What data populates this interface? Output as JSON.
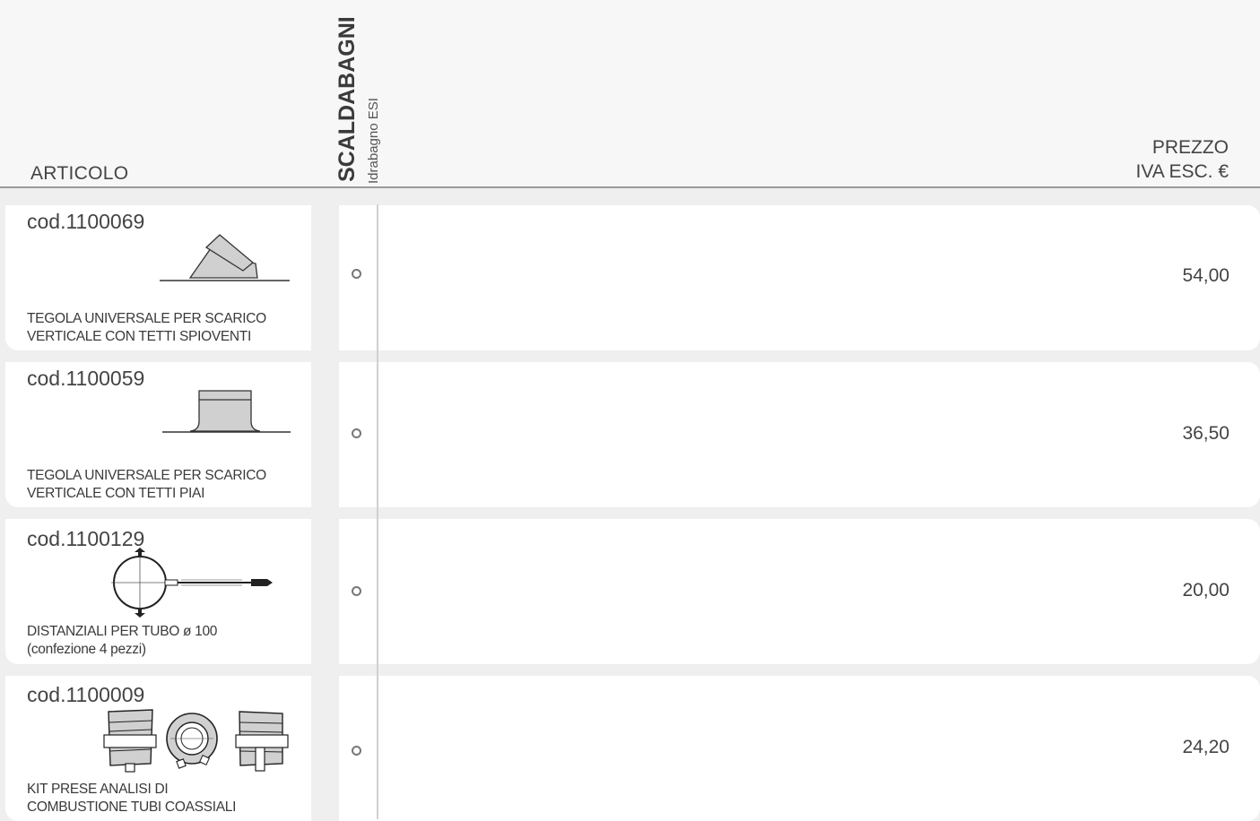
{
  "header": {
    "articolo_label": "ARTICOLO",
    "category_title": "SCALDABAGNI",
    "category_subtitle": "Idrabagno ESI",
    "price_line1": "PREZZO",
    "price_line2": "IVA ESC. €"
  },
  "rows": [
    {
      "code": "cod.1100069",
      "desc_line1": "TEGOLA UNIVERSALE PER SCARICO",
      "desc_line2": "VERTICALE CON TETTI SPIOVENTI",
      "price": "54,00",
      "icon": "sloped-roof-tile-icon"
    },
    {
      "code": "cod.1100059",
      "desc_line1": "TEGOLA UNIVERSALE PER SCARICO",
      "desc_line2": "VERTICALE CON TETTI PIAI",
      "price": "36,50",
      "icon": "flat-roof-tile-icon"
    },
    {
      "code": "cod.1100129",
      "desc_line1": "DISTANZIALI PER TUBO ø 100",
      "desc_line2": "(confezione 4 pezzi)",
      "price": "20,00",
      "icon": "pipe-spacer-icon"
    },
    {
      "code": "cod.1100009",
      "desc_line1": "KIT PRESE ANALISI DI",
      "desc_line2": "COMBUSTIONE TUBI COASSIALI",
      "price": "24,20",
      "icon": "combustion-analysis-kit-icon"
    }
  ],
  "colors": {
    "background": "#efefef",
    "card": "#ffffff",
    "text": "#3a3a3a",
    "drawing_fill": "#d0d0d0"
  }
}
